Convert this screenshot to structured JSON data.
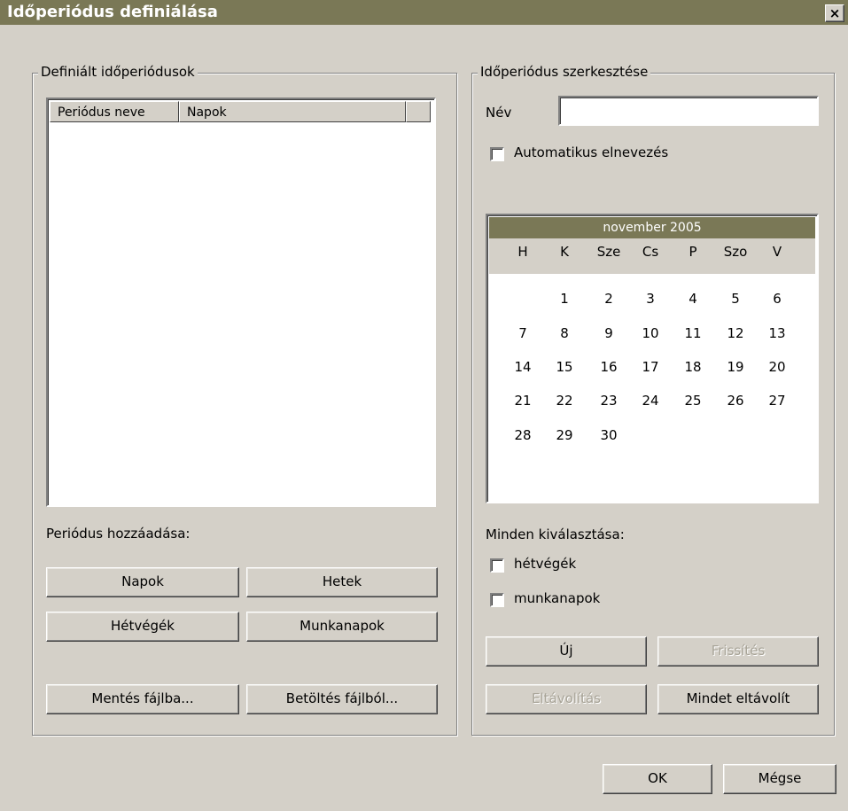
{
  "window": {
    "title": "Időperiódus definiálása",
    "close_glyph": "×"
  },
  "left_group": {
    "label": "Definiált időperiódusok",
    "columns": [
      "Periódus neve",
      "Napok"
    ],
    "add_label": "Periódus hozzáadása:",
    "buttons": {
      "napok": "Napok",
      "hetek": "Hetek",
      "hetvegek": "Hétvégék",
      "munkanapok": "Munkanapok",
      "mentes": "Mentés fájlba...",
      "betoltes": "Betöltés fájlból..."
    }
  },
  "right_group": {
    "label": "Időperiódus szerkesztése",
    "name_label": "Név",
    "name_value": "",
    "auto_name_label": "Automatikus elnevezés",
    "calendar": {
      "month_title": "november 2005",
      "weekdays": [
        "H",
        "K",
        "Sze",
        "Cs",
        "P",
        "Szo",
        "V"
      ],
      "weeks": [
        [
          "",
          "1",
          "2",
          "3",
          "4",
          "5",
          "6"
        ],
        [
          "7",
          "8",
          "9",
          "10",
          "11",
          "12",
          "13"
        ],
        [
          "14",
          "15",
          "16",
          "17",
          "18",
          "19",
          "20"
        ],
        [
          "21",
          "22",
          "23",
          "24",
          "25",
          "26",
          "27"
        ],
        [
          "28",
          "29",
          "30",
          "",
          "",
          "",
          ""
        ]
      ]
    },
    "select_all_label": "Minden kiválasztása:",
    "weekends_label": "hétvégék",
    "workdays_label": "munkanapok",
    "buttons": {
      "uj": "Új",
      "frissites": "Frissítés",
      "eltavolitas": "Eltávolítás",
      "mindet_eltavolit": "Mindet eltávolít"
    }
  },
  "footer": {
    "ok": "OK",
    "cancel": "Mégse"
  },
  "colors": {
    "titlebar": "#7a7856",
    "face": "#d4d0c8",
    "disabled_text": "#a8a498"
  }
}
